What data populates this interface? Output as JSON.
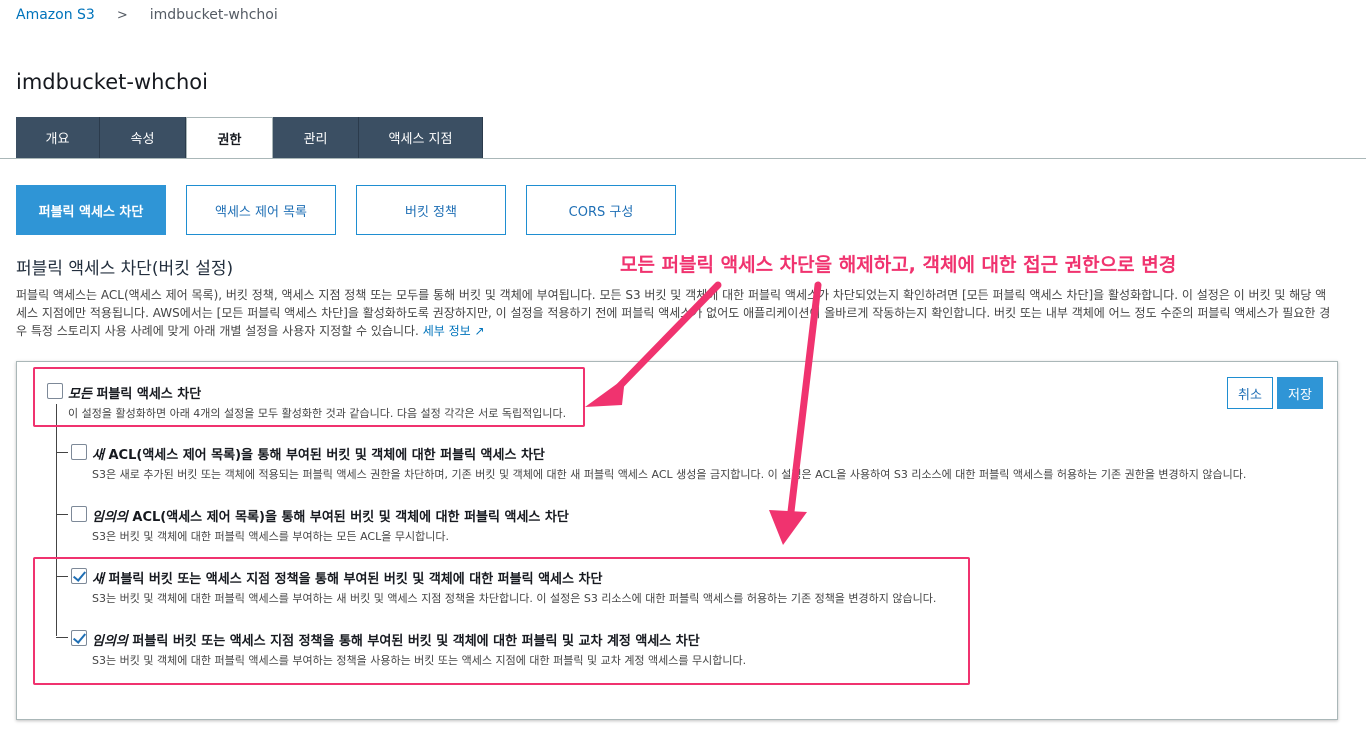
{
  "breadcrumb": {
    "root": "Amazon S3",
    "separator": ">",
    "current": "imdbucket-whchoi"
  },
  "bucket_title": "imdbucket-whchoi",
  "tabs": [
    {
      "label": "개요",
      "active": false
    },
    {
      "label": "속성",
      "active": false
    },
    {
      "label": "권한",
      "active": true
    },
    {
      "label": "관리",
      "active": false
    },
    {
      "label": "액세스 지점",
      "active": false
    }
  ],
  "subtabs": [
    {
      "label": "퍼블릭 액세스 차단",
      "active": true
    },
    {
      "label": "액세스 제어 목록",
      "active": false
    },
    {
      "label": "버킷 정책",
      "active": false
    },
    {
      "label": "CORS 구성",
      "active": false
    }
  ],
  "section_title": "퍼블릭 액세스 차단(버킷 설정)",
  "description": "퍼블릭 액세스는 ACL(액세스 제어 목록), 버킷 정책, 액세스 지점 정책 또는 모두를 통해 버킷 및 객체에 부여됩니다. 모든 S3 버킷 및 객체에 대한 퍼블릭 액세스가 차단되었는지 확인하려면 [모든 퍼블릭 액세스 차단]을 활성화합니다. 이 설정은 이 버킷 및 해당 액세스 지점에만 적용됩니다. AWS에서는 [모든 퍼블릭 액세스 차단]을 활성화하도록 권장하지만, 이 설정을 적용하기 전에 퍼블릭 액세스가 없어도 애플리케이션이 올바르게 작동하는지 확인합니다. 버킷 또는 내부 객체에 어느 정도 수준의 퍼블릭 액세스가 필요한 경우 특정 스토리지 사용 사례에 맞게 아래 개별 설정을 사용자 지정할 수 있습니다.",
  "more_info_link": "세부 정보",
  "buttons": {
    "cancel": "취소",
    "save": "저장"
  },
  "options": {
    "all": {
      "checked": false,
      "title_em": "모든",
      "title_rest": " 퍼블릭 액세스 차단",
      "desc": "이 설정을 활성화하면 아래 4개의 설정을 모두 활성화한 것과 같습니다. 다음 설정 각각은 서로 독립적입니다."
    },
    "items": [
      {
        "checked": false,
        "title_em": "새",
        "title_rest": " ACL(액세스 제어 목록)을 통해 부여된 버킷 및 객체에 대한 퍼블릭 액세스 차단",
        "desc": "S3은 새로 추가된 버킷 또는 객체에 적용되는 퍼블릭 액세스 권한을 차단하며, 기존 버킷 및 객체에 대한 새 퍼블릭 액세스 ACL 생성을 금지합니다. 이 설정은 ACL을 사용하여 S3 리소스에 대한 퍼블릭 액세스를 허용하는 기존 권한을 변경하지 않습니다."
      },
      {
        "checked": false,
        "title_em": "임의의",
        "title_rest": " ACL(액세스 제어 목록)을 통해 부여된 버킷 및 객체에 대한 퍼블릭 액세스 차단",
        "desc": "S3은 버킷 및 객체에 대한 퍼블릭 액세스를 부여하는 모든 ACL을 무시합니다."
      },
      {
        "checked": true,
        "title_em": "새",
        "title_rest": " 퍼블릭 버킷 또는 액세스 지점 정책을 통해 부여된 버킷 및 객체에 대한 퍼블릭 액세스 차단",
        "desc": "S3는 버킷 및 객체에 대한 퍼블릭 액세스를 부여하는 새 버킷 및 액세스 지점 정책을 차단합니다. 이 설정은 S3 리소스에 대한 퍼블릭 액세스를 허용하는 기존 정책을 변경하지 않습니다."
      },
      {
        "checked": true,
        "title_em": "임의의",
        "title_rest": " 퍼블릭 버킷 또는 액세스 지점 정책을 통해 부여된 버킷 및 객체에 대한 퍼블릭 및 교차 계정 액세스 차단",
        "desc": "S3는 버킷 및 객체에 대한 퍼블릭 액세스를 부여하는 정책을 사용하는 버킷 또는 액세스 지점에 대한 퍼블릭 및 교차 계정 액세스를 무시합니다."
      }
    ]
  },
  "annotation": {
    "text": "모든 퍼블릭 액세스 차단을 해제하고, 객체에 대한 접근 권한으로 변경",
    "color": "#f0336f"
  }
}
